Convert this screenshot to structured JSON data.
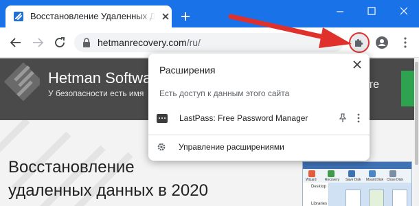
{
  "browser": {
    "tab": {
      "title": "Восстановление Удаленных Данных"
    },
    "address": {
      "host": "hetmanrecovery.com",
      "path": "/ru/"
    }
  },
  "page": {
    "brand": "Hetman Software",
    "tagline": "У безопасности есть имя",
    "header_right_text": "те",
    "hero_line1": "Восстановление",
    "hero_line2": "удаленных данных в 2020",
    "screenshot": {
      "tools": [
        "Wizard",
        "Recovery",
        "Save Disk",
        "Mount Disk",
        "Close Disk"
      ],
      "tree": [
        "Desktop",
        "Libraries"
      ]
    }
  },
  "extensions_popup": {
    "title": "Расширения",
    "subtitle": "Есть доступ к данным этого сайта",
    "extensions": [
      {
        "name": "LastPass: Free Password Manager"
      }
    ],
    "manage_label": "Управление расширениями"
  },
  "colors": {
    "accent": "#1a72e8",
    "annotation": "#e0302b",
    "site_header": "#4a4a4a",
    "cta": "#2ea24e"
  },
  "icons": [
    "favicon-icon",
    "close-icon",
    "plus-icon",
    "minimize-icon",
    "maximize-icon",
    "back-icon",
    "forward-icon",
    "reload-icon",
    "lock-icon",
    "puzzle-icon",
    "profile-icon",
    "menu-icon",
    "pin-icon",
    "gear-icon",
    "lastpass-icon"
  ]
}
